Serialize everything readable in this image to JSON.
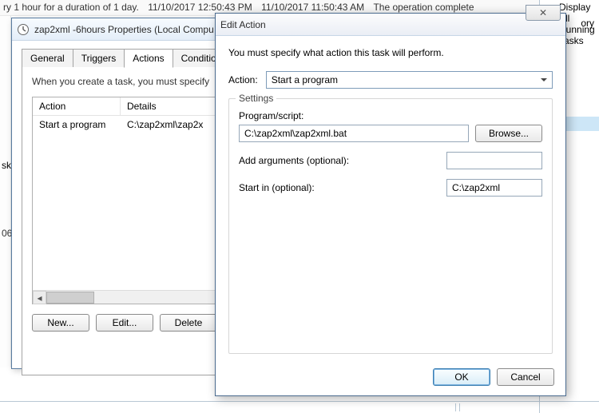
{
  "background": {
    "row_text": "ry 1 hour for a duration of 1 day.",
    "col_time1": "11/10/2017 12:50:43 PM",
    "col_time2": "11/10/2017 11:50:43 AM",
    "col_status": "The operation complete",
    "actions_link": "Display All Running Tasks",
    "side_label": "sk",
    "side_num": "06",
    "right_cut": "ory"
  },
  "props": {
    "title": "zap2xml -6hours Properties (Local Compu",
    "tabs": [
      "General",
      "Triggers",
      "Actions",
      "Conditions"
    ],
    "active_tab": 2,
    "description": "When you create a task, you must specify",
    "columns": {
      "action": "Action",
      "details": "Details"
    },
    "row": {
      "action": "Start a program",
      "details": "C:\\zap2xml\\zap2x"
    },
    "buttons": {
      "new": "New...",
      "edit": "Edit...",
      "delete": "Delete"
    }
  },
  "edit": {
    "title": "Edit Action",
    "description": "You must specify what action this task will perform.",
    "action_label": "Action:",
    "action_value": "Start a program",
    "settings_label": "Settings",
    "program_label": "Program/script:",
    "program_value": "C:\\zap2xml\\zap2xml.bat",
    "browse": "Browse...",
    "args_label": "Add arguments (optional):",
    "args_value": "",
    "startin_label": "Start in (optional):",
    "startin_value": "C:\\zap2xml",
    "ok": "OK",
    "cancel": "Cancel",
    "close_x": "✕"
  }
}
